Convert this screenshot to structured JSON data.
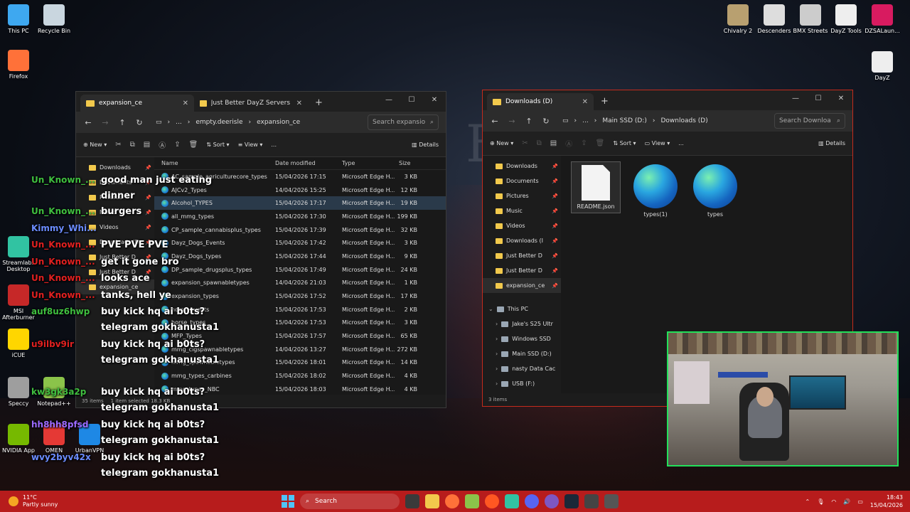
{
  "desktop": {
    "left_icons": [
      {
        "label": "This PC",
        "icon": "monitor-icon",
        "color": "#3ea8f0"
      },
      {
        "label": "Recycle Bin",
        "icon": "recycle-bin-icon",
        "color": "#c9d6df"
      },
      {
        "label": "Firefox",
        "icon": "firefox-icon",
        "color": "#ff7139"
      },
      {
        "label": "Streamlabs Desktop",
        "icon": "streamlabs-icon",
        "color": "#31c3a2"
      },
      {
        "label": "MSI Afterburner",
        "icon": "msi-afterburner-icon",
        "color": "#c62828"
      },
      {
        "label": "iCUE",
        "icon": "icue-icon",
        "color": "#ffd600"
      },
      {
        "label": "Speccy",
        "icon": "speccy-icon",
        "color": "#9e9e9e"
      },
      {
        "label": "Notepad++",
        "icon": "notepad-plus-plus-icon",
        "color": "#8bc34a"
      },
      {
        "label": "NVIDIA App",
        "icon": "nvidia-icon",
        "color": "#76b900"
      },
      {
        "label": "OMEN",
        "icon": "omen-icon",
        "color": "#e53935"
      },
      {
        "label": "UrbanVPN",
        "icon": "urbanvpn-icon",
        "color": "#1e88e5"
      }
    ],
    "right_icons": [
      {
        "label": "Chivalry 2",
        "icon": "chivalry-icon",
        "color": "#b8a070"
      },
      {
        "label": "Descenders",
        "icon": "descenders-icon",
        "color": "#dddddd"
      },
      {
        "label": "BMX Streets",
        "icon": "bmx-streets-icon",
        "color": "#cccccc"
      },
      {
        "label": "DayZ Tools",
        "icon": "dayz-tools-icon",
        "color": "#eeeeee"
      },
      {
        "label": "DZSALaun...",
        "icon": "dzsa-launcher-icon",
        "color": "#d81b60"
      },
      {
        "label": "DayZ",
        "icon": "dayz-icon",
        "color": "#eeeeee"
      }
    ]
  },
  "chat": [
    {
      "user": "Un_Known_...",
      "user_color": "#3fbf3f",
      "message": "good man just eating"
    },
    {
      "user": "",
      "user_color": "#ffffff",
      "message": "dinner"
    },
    {
      "user": "Un_Known_...",
      "user_color": "#3fbf3f",
      "message": "burgers"
    },
    {
      "user": "Kimmy_Whi...",
      "user_color": "#6b8cff",
      "message": ""
    },
    {
      "user": "Un_Known_...",
      "user_color": "#e02020",
      "message": "PVE PVE PVE"
    },
    {
      "user": "Un_Known_...",
      "user_color": "#e02020",
      "message": "get it gone bro"
    },
    {
      "user": "Un_Known_...",
      "user_color": "#e02020",
      "message": "looks ace"
    },
    {
      "user": "Un_Known_...",
      "user_color": "#e02020",
      "message": "tanks, hell ye"
    },
    {
      "user": "auf8uz6hwp",
      "user_color": "#3fbf3f",
      "message": "buy kick hq ai b0ts?"
    },
    {
      "user": "",
      "user_color": "#ffffff",
      "message": "telegram gokhanusta1"
    },
    {
      "user": "u9ilbv9ir",
      "user_color": "#e02020",
      "message": "buy kick hq ai b0ts?"
    },
    {
      "user": "",
      "user_color": "#ffffff",
      "message": "telegram gokhanusta1"
    },
    {
      "user": "kw3gk3a2p",
      "user_color": "#3fbf3f",
      "message": "buy kick hq ai b0ts?"
    },
    {
      "user": "",
      "user_color": "#ffffff",
      "message": "telegram gokhanusta1"
    },
    {
      "user": "hh8hh8pfsd",
      "user_color": "#9c6bff",
      "message": "buy kick hq ai b0ts?"
    },
    {
      "user": "",
      "user_color": "#ffffff",
      "message": "telegram gokhanusta1"
    },
    {
      "user": "wvy2byv42x",
      "user_color": "#6b8cff",
      "message": "buy kick hq ai b0ts?"
    },
    {
      "user": "",
      "user_color": "#ffffff",
      "message": "telegram gokhanusta1"
    }
  ],
  "explorer_left": {
    "tabs": [
      {
        "label": "expansion_ce"
      },
      {
        "label": "Just Better DayZ Servers Serve"
      }
    ],
    "breadcrumbs": [
      "...",
      "empty.deerisle",
      "expansion_ce"
    ],
    "search_placeholder": "Search expansio",
    "toolbar": {
      "new": "New",
      "sort": "Sort",
      "view": "View",
      "more": "...",
      "details": "Details"
    },
    "nav": [
      {
        "label": "Downloads",
        "pinned": true
      },
      {
        "label": "Documents",
        "pinned": true
      },
      {
        "label": "Pictures",
        "pinned": true
      },
      {
        "label": "Music",
        "pinned": true
      },
      {
        "label": "Videos",
        "pinned": true
      },
      {
        "label": "Downloads (D",
        "pinned": true
      },
      {
        "label": "Just Better D",
        "pinned": true
      },
      {
        "label": "Just Better D",
        "pinned": true
      },
      {
        "label": "expansion_ce",
        "pinned": false
      }
    ],
    "columns": {
      "name": "Name",
      "date": "Date modified",
      "type": "Type",
      "size": "Size"
    },
    "files": [
      {
        "name": "AC_sample_agriculturecore_types",
        "date": "15/04/2026 17:15",
        "type": "Microsoft Edge H...",
        "size": "3 KB"
      },
      {
        "name": "AJCv2_Types",
        "date": "14/04/2026 15:25",
        "type": "Microsoft Edge H...",
        "size": "12 KB"
      },
      {
        "name": "Alcohol_TYPES",
        "date": "15/04/2026 17:17",
        "type": "Microsoft Edge H...",
        "size": "19 KB"
      },
      {
        "name": "all_mmg_types",
        "date": "15/04/2026 17:30",
        "type": "Microsoft Edge H...",
        "size": "199 KB"
      },
      {
        "name": "CP_sample_cannabisplus_types",
        "date": "15/04/2026 17:39",
        "type": "Microsoft Edge H...",
        "size": "32 KB"
      },
      {
        "name": "Dayz_Dogs_Events",
        "date": "15/04/2026 17:42",
        "type": "Microsoft Edge H...",
        "size": "3 KB"
      },
      {
        "name": "Dayz_Dogs_types",
        "date": "15/04/2026 17:44",
        "type": "Microsoft Edge H...",
        "size": "9 KB"
      },
      {
        "name": "DP_sample_drugsplus_types",
        "date": "15/04/2026 17:49",
        "type": "Microsoft Edge H...",
        "size": "24 KB"
      },
      {
        "name": "expansion_spawnabletypes",
        "date": "14/04/2026 21:03",
        "type": "Microsoft Edge H...",
        "size": "1 KB"
      },
      {
        "name": "expansion_types",
        "date": "15/04/2026 17:52",
        "type": "Microsoft Edge H...",
        "size": "17 KB"
      },
      {
        "name": "horse_events",
        "date": "15/04/2026 17:53",
        "type": "Microsoft Edge H...",
        "size": "2 KB"
      },
      {
        "name": "horse_types",
        "date": "15/04/2026 17:53",
        "type": "Microsoft Edge H...",
        "size": "3 KB"
      },
      {
        "name": "MFP_Types",
        "date": "15/04/2026 17:57",
        "type": "Microsoft Edge H...",
        "size": "65 KB"
      },
      {
        "name": "mmg_cigspawnabletypes",
        "date": "14/04/2026 13:27",
        "type": "Microsoft Edge H...",
        "size": "272 KB"
      },
      {
        "name": "mmg_spawnabletypes",
        "date": "15/04/2026 18:01",
        "type": "Microsoft Edge H...",
        "size": "14 KB"
      },
      {
        "name": "mmg_types_carbines",
        "date": "15/04/2026 18:02",
        "type": "Microsoft Edge H...",
        "size": "4 KB"
      },
      {
        "name": "mmg_types_NBC",
        "date": "15/04/2026 18:03",
        "type": "Microsoft Edge H...",
        "size": "4 KB"
      }
    ],
    "selected_index": 2,
    "status": {
      "count": "35 items",
      "selected": "1 item selected  18.3 KB"
    }
  },
  "explorer_right": {
    "tabs": [
      {
        "label": "Downloads (D)"
      }
    ],
    "breadcrumbs": [
      "...",
      "Main SSD (D:)",
      "Downloads (D)"
    ],
    "search_placeholder": "Search Downloa",
    "toolbar": {
      "new": "New",
      "sort": "Sort",
      "view": "View",
      "more": "...",
      "details": "Details"
    },
    "nav_quick": [
      {
        "label": "Downloads",
        "icon": "downloads-icon"
      },
      {
        "label": "Documents",
        "icon": "documents-icon"
      },
      {
        "label": "Pictures",
        "icon": "pictures-icon"
      },
      {
        "label": "Music",
        "icon": "music-icon"
      },
      {
        "label": "Videos",
        "icon": "videos-icon"
      },
      {
        "label": "Downloads (I",
        "icon": "folder-icon"
      },
      {
        "label": "Just Better D",
        "icon": "folder-icon"
      },
      {
        "label": "Just Better D",
        "icon": "folder-icon"
      },
      {
        "label": "expansion_ce",
        "icon": "folder-icon"
      }
    ],
    "nav_pc": [
      {
        "label": "This PC",
        "icon": "monitor-icon"
      },
      {
        "label": "Jake's S25 Ultr",
        "icon": "phone-icon"
      },
      {
        "label": "Windows SSD",
        "icon": "drive-icon"
      },
      {
        "label": "Main SSD (D:)",
        "icon": "drive-icon"
      },
      {
        "label": "nasty Data Cac",
        "icon": "drive-icon"
      },
      {
        "label": "USB (F:)",
        "icon": "drive-icon"
      }
    ],
    "files": [
      {
        "name": "README.json",
        "kind": "document"
      },
      {
        "name": "types(1)",
        "kind": "edge"
      },
      {
        "name": "types",
        "kind": "edge"
      }
    ],
    "status": {
      "count": "3 items"
    }
  },
  "taskbar": {
    "weather_temp": "11°C",
    "weather_text": "Partly sunny",
    "search": "Search",
    "time": "18:43",
    "date": "15/04/2026"
  },
  "wallpaper_letter": "E"
}
